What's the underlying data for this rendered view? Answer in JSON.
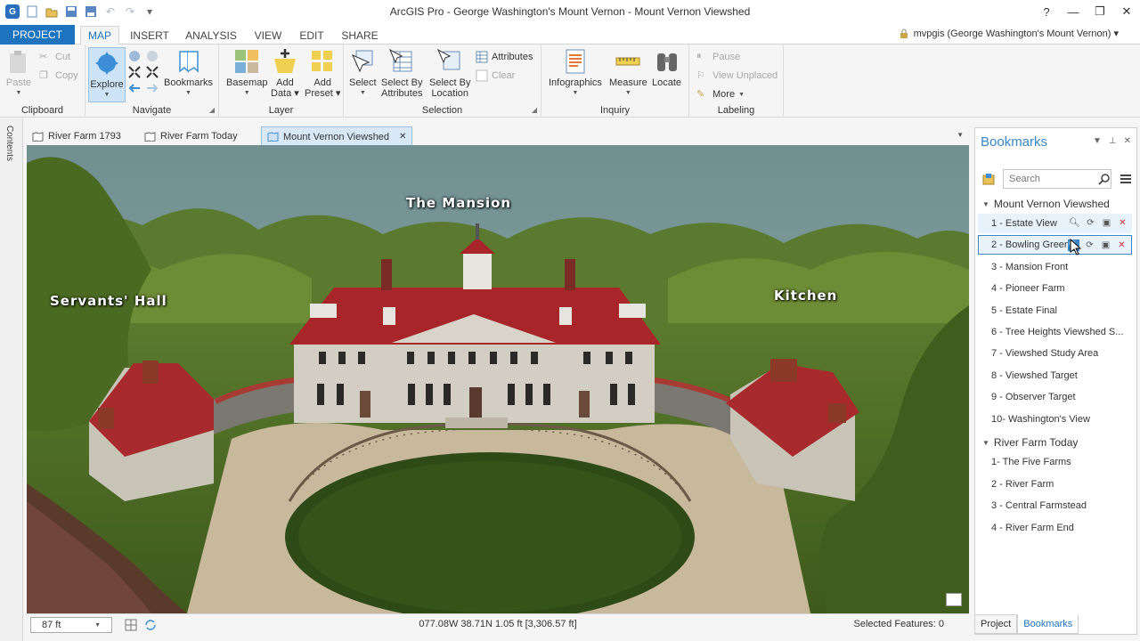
{
  "window": {
    "title": "ArcGIS Pro - George Washington's Mount Vernon - Mount Vernon Viewshed",
    "help": "?",
    "minimize": "—",
    "maximize": "❐",
    "close": "✕"
  },
  "ribbon_tabs": [
    "PROJECT",
    "MAP",
    "INSERT",
    "ANALYSIS",
    "VIEW",
    "EDIT",
    "SHARE"
  ],
  "active_tab": "MAP",
  "user": "mvpgis (George Washington's Mount Vernon) ▾",
  "ribbon": {
    "clipboard": {
      "label": "Clipboard",
      "paste": "Paste",
      "cut": "Cut",
      "copy": "Copy"
    },
    "navigate": {
      "label": "Navigate",
      "explore": "Explore",
      "bookmarks": "Bookmarks"
    },
    "layer": {
      "label": "Layer",
      "basemap": "Basemap",
      "add_data": "Add\nData",
      "add_preset": "Add\nPreset"
    },
    "selection": {
      "label": "Selection",
      "select": "Select",
      "select_by_attributes": "Select By\nAttributes",
      "select_by_location": "Select By\nLocation",
      "attributes": "Attributes",
      "clear": "Clear"
    },
    "inquiry": {
      "label": "Inquiry",
      "infographics": "Infographics",
      "measure": "Measure",
      "locate": "Locate"
    },
    "labeling": {
      "label": "Labeling",
      "pause": "Pause",
      "view_unplaced": "View Unplaced",
      "more": "More"
    }
  },
  "contents_label": "Contents",
  "view_tabs": [
    {
      "label": "River Farm 1793",
      "active": false
    },
    {
      "label": "River Farm Today",
      "active": false
    },
    {
      "label": "Mount Vernon Viewshed",
      "active": true,
      "close": "✕"
    }
  ],
  "map_labels": {
    "mansion": "The Mansion",
    "servants_hall": "Servants' Hall",
    "kitchen": "Kitchen"
  },
  "status": {
    "scale": "87 ft",
    "coordinates": "077.08W 38.71N  1.05 ft  [3,306.57 ft]",
    "selected_features": "Selected Features: 0"
  },
  "bookmarks_pane": {
    "title": "Bookmarks",
    "search_placeholder": "Search",
    "groups": [
      {
        "name": "Mount Vernon Viewshed",
        "items": [
          "1 - Estate View",
          "2 - Bowling Green",
          "3 - Mansion Front",
          "4 - Pioneer Farm",
          "5 - Estate Final",
          "6 - Tree Heights Viewshed S...",
          "7 - Viewshed Study Area",
          "8 - Viewshed Target",
          "9 - Observer Target",
          "10- Washington's View"
        ]
      },
      {
        "name": "River Farm Today",
        "items": [
          "1- The Five Farms",
          "2 - River Farm",
          "3 - Central Farmstead",
          "4 - River Farm End"
        ]
      }
    ],
    "bottom_tabs": [
      "Project",
      "Bookmarks"
    ],
    "active_bottom_tab": "Bookmarks"
  },
  "colors": {
    "accent": "#1e73be",
    "roof": "#b0282c",
    "wall": "#d6d2c8",
    "lawn": "#3d5a1f",
    "sky": "#7f9e9a"
  }
}
